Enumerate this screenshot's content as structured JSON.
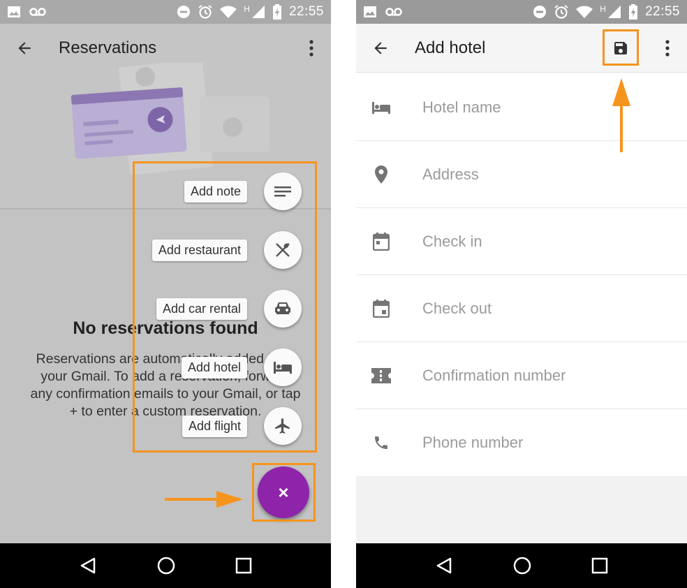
{
  "left": {
    "status": {
      "time": "22:55",
      "network": "H"
    },
    "title": "Reservations",
    "empty_title": "No reservations found",
    "empty_text": "Reservations are automatically added from your Gmail. To add a reservation, forward any confirmation emails to your Gmail, or tap + to enter a custom reservation.",
    "speed_dial": [
      {
        "label": "Add note",
        "icon": "notes-icon"
      },
      {
        "label": "Add restaurant",
        "icon": "restaurant-icon"
      },
      {
        "label": "Add car rental",
        "icon": "car-icon"
      },
      {
        "label": "Add hotel",
        "icon": "hotel-icon"
      },
      {
        "label": "Add flight",
        "icon": "flight-icon"
      }
    ],
    "fab_symbol": "×"
  },
  "right": {
    "status": {
      "time": "22:55",
      "network": "H"
    },
    "title": "Add hotel",
    "fields": [
      {
        "placeholder": "Hotel name",
        "icon": "hotel-icon"
      },
      {
        "placeholder": "Address",
        "icon": "location-pin-icon"
      },
      {
        "placeholder": "Check in",
        "icon": "calendar-icon"
      },
      {
        "placeholder": "Check out",
        "icon": "calendar-event-icon"
      },
      {
        "placeholder": "Confirmation number",
        "icon": "ticket-icon"
      },
      {
        "placeholder": "Phone number",
        "icon": "phone-icon"
      }
    ]
  },
  "colors": {
    "accent": "#8e24aa",
    "highlight": "#f7941d",
    "icon_grey": "#757575"
  }
}
